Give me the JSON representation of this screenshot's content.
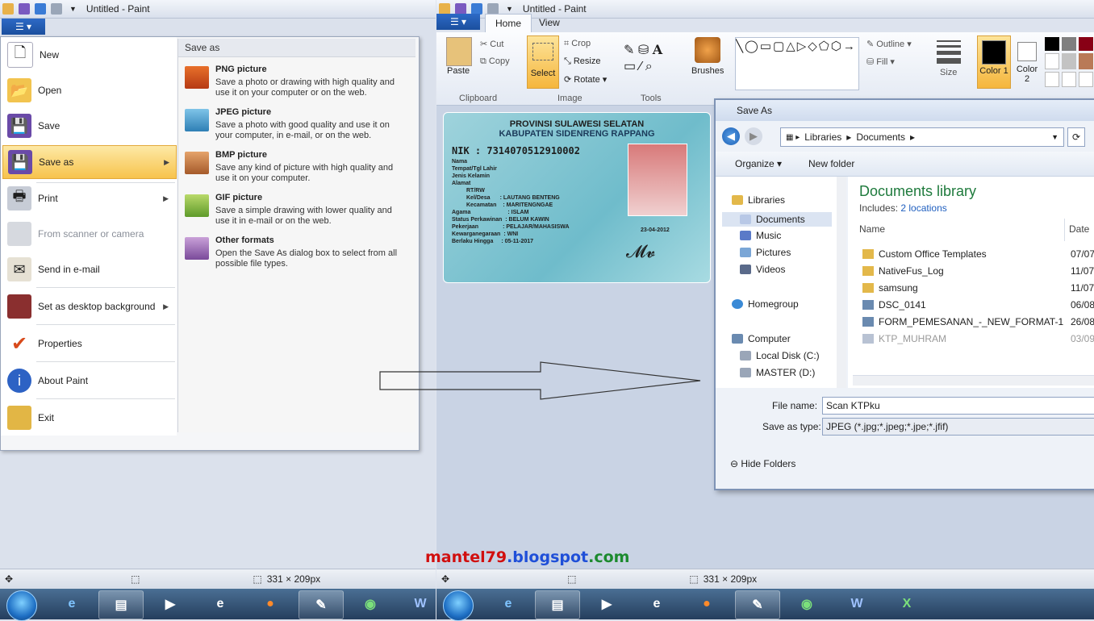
{
  "left": {
    "title": "Untitled - Paint",
    "menu": [
      {
        "label": "New",
        "icon": "new-document-icon",
        "arrow": false
      },
      {
        "label": "Open",
        "icon": "open-folder-icon",
        "arrow": false
      },
      {
        "label": "Save",
        "icon": "save-disk-icon",
        "arrow": false
      },
      {
        "label": "Save as",
        "icon": "save-as-icon",
        "arrow": true
      },
      {
        "label": "Print",
        "icon": "printer-icon",
        "arrow": true
      },
      {
        "label": "From scanner or camera",
        "icon": "scanner-icon",
        "arrow": false
      },
      {
        "label": "Send in e-mail",
        "icon": "email-icon",
        "arrow": false
      },
      {
        "label": "Set as desktop background",
        "icon": "desktop-icon",
        "arrow": true
      },
      {
        "label": "Properties",
        "icon": "checkmark-icon",
        "arrow": false
      },
      {
        "label": "About Paint",
        "icon": "info-icon",
        "arrow": false
      },
      {
        "label": "Exit",
        "icon": "exit-icon",
        "arrow": false
      }
    ],
    "submenu": {
      "title": "Save as",
      "items": [
        {
          "head": "PNG picture",
          "desc": "Save a photo or drawing with high quality and use it on your computer or on the web."
        },
        {
          "head": "JPEG picture",
          "desc": "Save a photo with good quality and use it on your computer, in e-mail, or on the web."
        },
        {
          "head": "BMP picture",
          "desc": "Save any kind of picture with high quality and use it on your computer."
        },
        {
          "head": "GIF picture",
          "desc": "Save a simple drawing with lower quality and use it in e-mail or on the web."
        },
        {
          "head": "Other formats",
          "desc": "Open the Save As dialog box to select from all possible file types."
        }
      ]
    },
    "status_size": "331 × 209px"
  },
  "right": {
    "title": "Untitled - Paint",
    "tabs": [
      "Home",
      "View"
    ],
    "clipboard": {
      "paste": "Paste",
      "cut": "Cut",
      "copy": "Copy",
      "label": "Clipboard"
    },
    "image": {
      "select": "Select",
      "crop": "Crop",
      "resize": "Resize",
      "rotate": "Rotate",
      "label": "Image"
    },
    "tools_label": "Tools",
    "brushes": "Brushes",
    "outline": "Outline",
    "fill": "Fill",
    "size": "Size",
    "color1": "Color 1",
    "color2": "Color 2",
    "card": {
      "province": "PROVINSI SULAWESI SELATAN",
      "kabupaten": "KABUPATEN SIDENRENG RAPPANG",
      "nik": "NIK   :  7314070512910002",
      "fields": [
        {
          "k": "Nama",
          "v": ""
        },
        {
          "k": "Tempat/Tgl Lahir",
          "v": ""
        },
        {
          "k": "Jenis Kelamin",
          "v": ""
        },
        {
          "k": "Alamat",
          "v": ""
        },
        {
          "k": "RT/RW",
          "v": ""
        },
        {
          "k": "Kel/Desa",
          "v": ": LAUTANG BENTENG"
        },
        {
          "k": "Kecamatan",
          "v": ": MARITENGNGAE"
        },
        {
          "k": "Agama",
          "v": ": ISLAM"
        },
        {
          "k": "Status Perkawinan",
          "v": ": BELUM KAWIN"
        },
        {
          "k": "Pekerjaan",
          "v": ": PELAJAR/MAHASISWA"
        },
        {
          "k": "Kewarganegaraan",
          "v": ": WNI"
        },
        {
          "k": "Berlaku Hingga",
          "v": ": 05-11-2017"
        }
      ],
      "date": "23-04-2012"
    },
    "dialog": {
      "title": "Save As",
      "path": [
        "Libraries",
        "Documents"
      ],
      "organize": "Organize",
      "new_folder": "New folder",
      "nav": [
        "Libraries",
        "Documents",
        "Music",
        "Pictures",
        "Videos",
        "Homegroup",
        "Computer",
        "Local Disk (C:)",
        "MASTER (D:)"
      ],
      "library_title": "Documents library",
      "includes": "Includes:",
      "locations": "2 locations",
      "col_name": "Name",
      "col_date": "Date",
      "files": [
        {
          "name": "Custom Office Templates",
          "date": "07/07"
        },
        {
          "name": "NativeFus_Log",
          "date": "11/07"
        },
        {
          "name": "samsung",
          "date": "11/07"
        },
        {
          "name": "DSC_0141",
          "date": "06/08"
        },
        {
          "name": "FORM_PEMESANAN_-_NEW_FORMAT-1",
          "date": "26/08"
        },
        {
          "name": "KTP_MUHRAM",
          "date": "03/09"
        }
      ],
      "file_name_label": "File name:",
      "file_name": "Scan KTPku",
      "save_type_label": "Save as type:",
      "save_type": "JPEG (*.jpg;*.jpeg;*.jpe;*.jfif)",
      "hide_folders": "Hide Folders"
    },
    "status_size": "331 × 209px"
  },
  "watermark": {
    "a": "mantel79",
    "b": ".blogspot",
    "c": ".com"
  },
  "colors": {
    "red": "#d10f0f",
    "blue": "#1f4fd8",
    "green": "#1c8a2e"
  }
}
